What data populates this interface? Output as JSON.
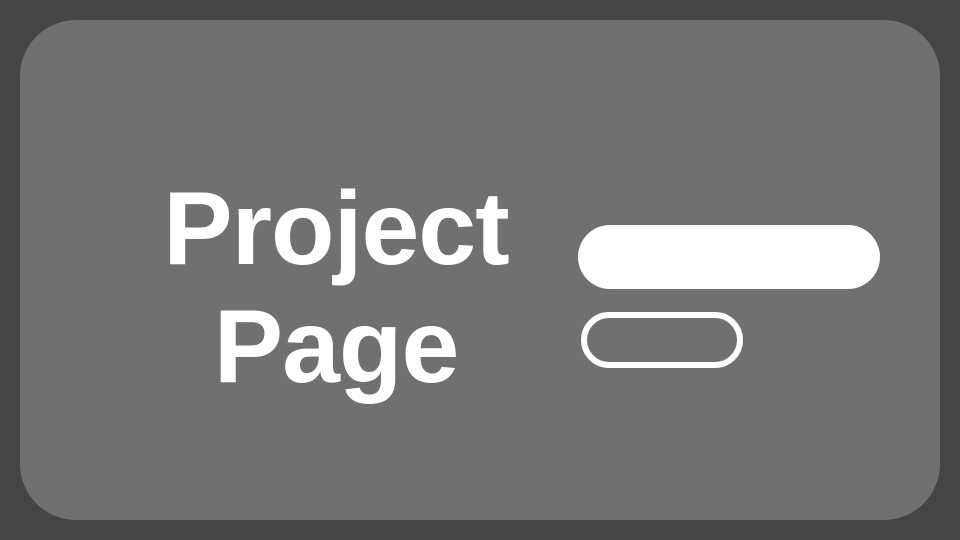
{
  "card": {
    "title_line_1": "Project",
    "title_line_2": "Page"
  },
  "colors": {
    "page_background": "#454545",
    "card_background": "#707070",
    "foreground": "#ffffff"
  },
  "icons": {
    "filled_bar": "filled-pill-icon",
    "outline_bar": "outline-pill-icon"
  }
}
